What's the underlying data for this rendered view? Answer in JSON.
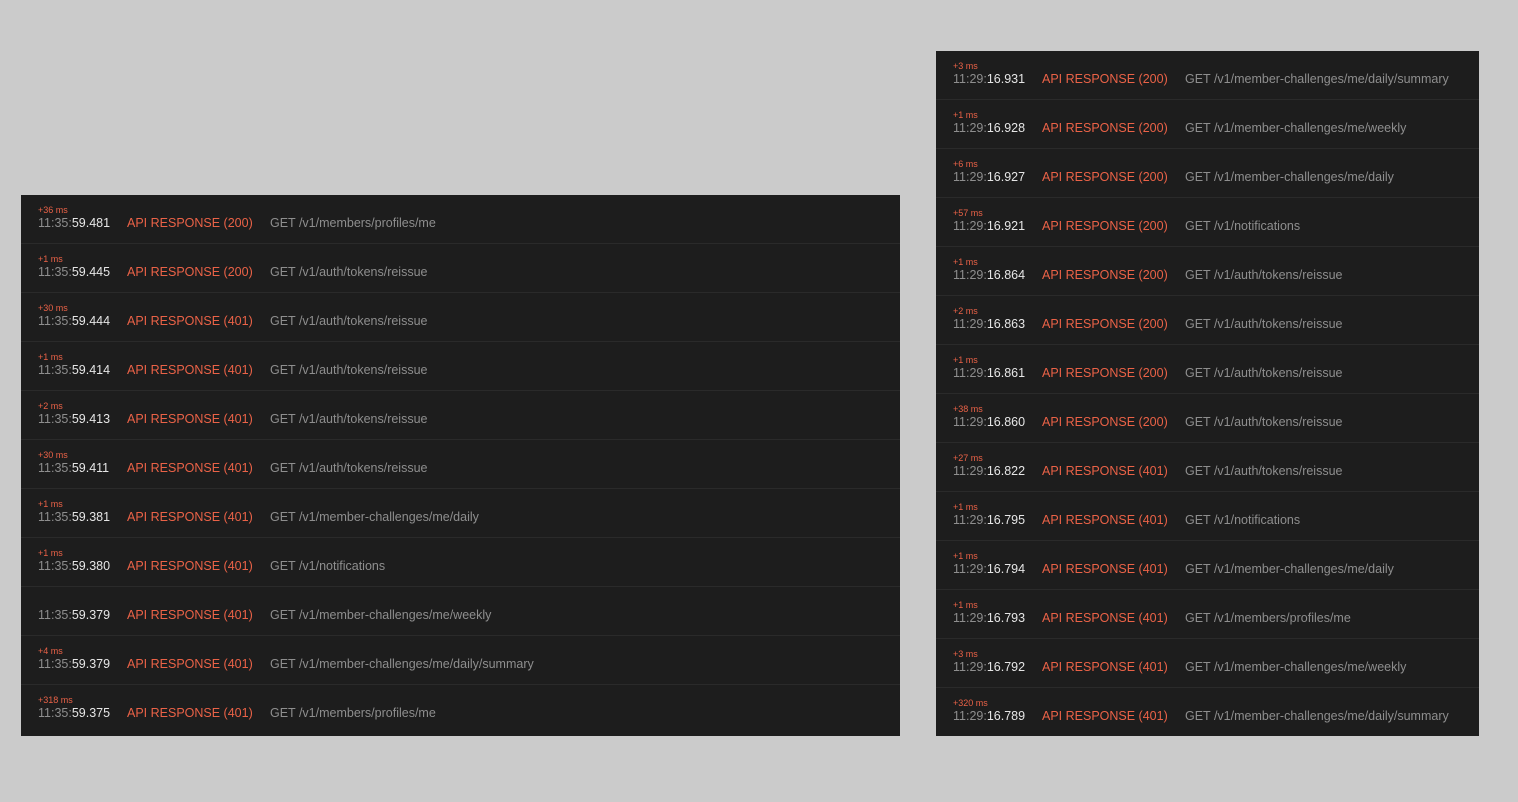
{
  "panels": [
    {
      "rows": [
        {
          "delta": "+36 ms",
          "time_prefix": "11:35:",
          "time_seconds": "59.481",
          "status": "API RESPONSE (200)",
          "request": "GET /v1/members/profiles/me"
        },
        {
          "delta": "+1 ms",
          "time_prefix": "11:35:",
          "time_seconds": "59.445",
          "status": "API RESPONSE (200)",
          "request": "GET /v1/auth/tokens/reissue"
        },
        {
          "delta": "+30 ms",
          "time_prefix": "11:35:",
          "time_seconds": "59.444",
          "status": "API RESPONSE (401)",
          "request": "GET /v1/auth/tokens/reissue"
        },
        {
          "delta": "+1 ms",
          "time_prefix": "11:35:",
          "time_seconds": "59.414",
          "status": "API RESPONSE (401)",
          "request": "GET /v1/auth/tokens/reissue"
        },
        {
          "delta": "+2 ms",
          "time_prefix": "11:35:",
          "time_seconds": "59.413",
          "status": "API RESPONSE (401)",
          "request": "GET /v1/auth/tokens/reissue"
        },
        {
          "delta": "+30 ms",
          "time_prefix": "11:35:",
          "time_seconds": "59.411",
          "status": "API RESPONSE (401)",
          "request": "GET /v1/auth/tokens/reissue"
        },
        {
          "delta": "+1 ms",
          "time_prefix": "11:35:",
          "time_seconds": "59.381",
          "status": "API RESPONSE (401)",
          "request": "GET /v1/member-challenges/me/daily"
        },
        {
          "delta": "+1 ms",
          "time_prefix": "11:35:",
          "time_seconds": "59.380",
          "status": "API RESPONSE (401)",
          "request": "GET /v1/notifications"
        },
        {
          "delta": "",
          "time_prefix": "11:35:",
          "time_seconds": "59.379",
          "status": "API RESPONSE (401)",
          "request": "GET /v1/member-challenges/me/weekly"
        },
        {
          "delta": "+4 ms",
          "time_prefix": "11:35:",
          "time_seconds": "59.379",
          "status": "API RESPONSE (401)",
          "request": "GET /v1/member-challenges/me/daily/summary"
        },
        {
          "delta": "+318 ms",
          "time_prefix": "11:35:",
          "time_seconds": "59.375",
          "status": "API RESPONSE (401)",
          "request": "GET /v1/members/profiles/me"
        }
      ]
    },
    {
      "rows": [
        {
          "delta": "+3 ms",
          "time_prefix": "11:29:",
          "time_seconds": "16.931",
          "status": "API RESPONSE (200)",
          "request": "GET /v1/member-challenges/me/daily/summary"
        },
        {
          "delta": "+1 ms",
          "time_prefix": "11:29:",
          "time_seconds": "16.928",
          "status": "API RESPONSE (200)",
          "request": "GET /v1/member-challenges/me/weekly"
        },
        {
          "delta": "+6 ms",
          "time_prefix": "11:29:",
          "time_seconds": "16.927",
          "status": "API RESPONSE (200)",
          "request": "GET /v1/member-challenges/me/daily"
        },
        {
          "delta": "+57 ms",
          "time_prefix": "11:29:",
          "time_seconds": "16.921",
          "status": "API RESPONSE (200)",
          "request": "GET /v1/notifications"
        },
        {
          "delta": "+1 ms",
          "time_prefix": "11:29:",
          "time_seconds": "16.864",
          "status": "API RESPONSE (200)",
          "request": "GET /v1/auth/tokens/reissue"
        },
        {
          "delta": "+2 ms",
          "time_prefix": "11:29:",
          "time_seconds": "16.863",
          "status": "API RESPONSE (200)",
          "request": "GET /v1/auth/tokens/reissue"
        },
        {
          "delta": "+1 ms",
          "time_prefix": "11:29:",
          "time_seconds": "16.861",
          "status": "API RESPONSE (200)",
          "request": "GET /v1/auth/tokens/reissue"
        },
        {
          "delta": "+38 ms",
          "time_prefix": "11:29:",
          "time_seconds": "16.860",
          "status": "API RESPONSE (200)",
          "request": "GET /v1/auth/tokens/reissue"
        },
        {
          "delta": "+27 ms",
          "time_prefix": "11:29:",
          "time_seconds": "16.822",
          "status": "API RESPONSE (401)",
          "request": "GET /v1/auth/tokens/reissue"
        },
        {
          "delta": "+1 ms",
          "time_prefix": "11:29:",
          "time_seconds": "16.795",
          "status": "API RESPONSE (401)",
          "request": "GET /v1/notifications"
        },
        {
          "delta": "+1 ms",
          "time_prefix": "11:29:",
          "time_seconds": "16.794",
          "status": "API RESPONSE (401)",
          "request": "GET /v1/member-challenges/me/daily"
        },
        {
          "delta": "+1 ms",
          "time_prefix": "11:29:",
          "time_seconds": "16.793",
          "status": "API RESPONSE (401)",
          "request": "GET /v1/members/profiles/me"
        },
        {
          "delta": "+3 ms",
          "time_prefix": "11:29:",
          "time_seconds": "16.792",
          "status": "API RESPONSE (401)",
          "request": "GET /v1/member-challenges/me/weekly"
        },
        {
          "delta": "+320 ms",
          "time_prefix": "11:29:",
          "time_seconds": "16.789",
          "status": "API RESPONSE (401)",
          "request": "GET /v1/member-challenges/me/daily/summary"
        }
      ]
    }
  ]
}
